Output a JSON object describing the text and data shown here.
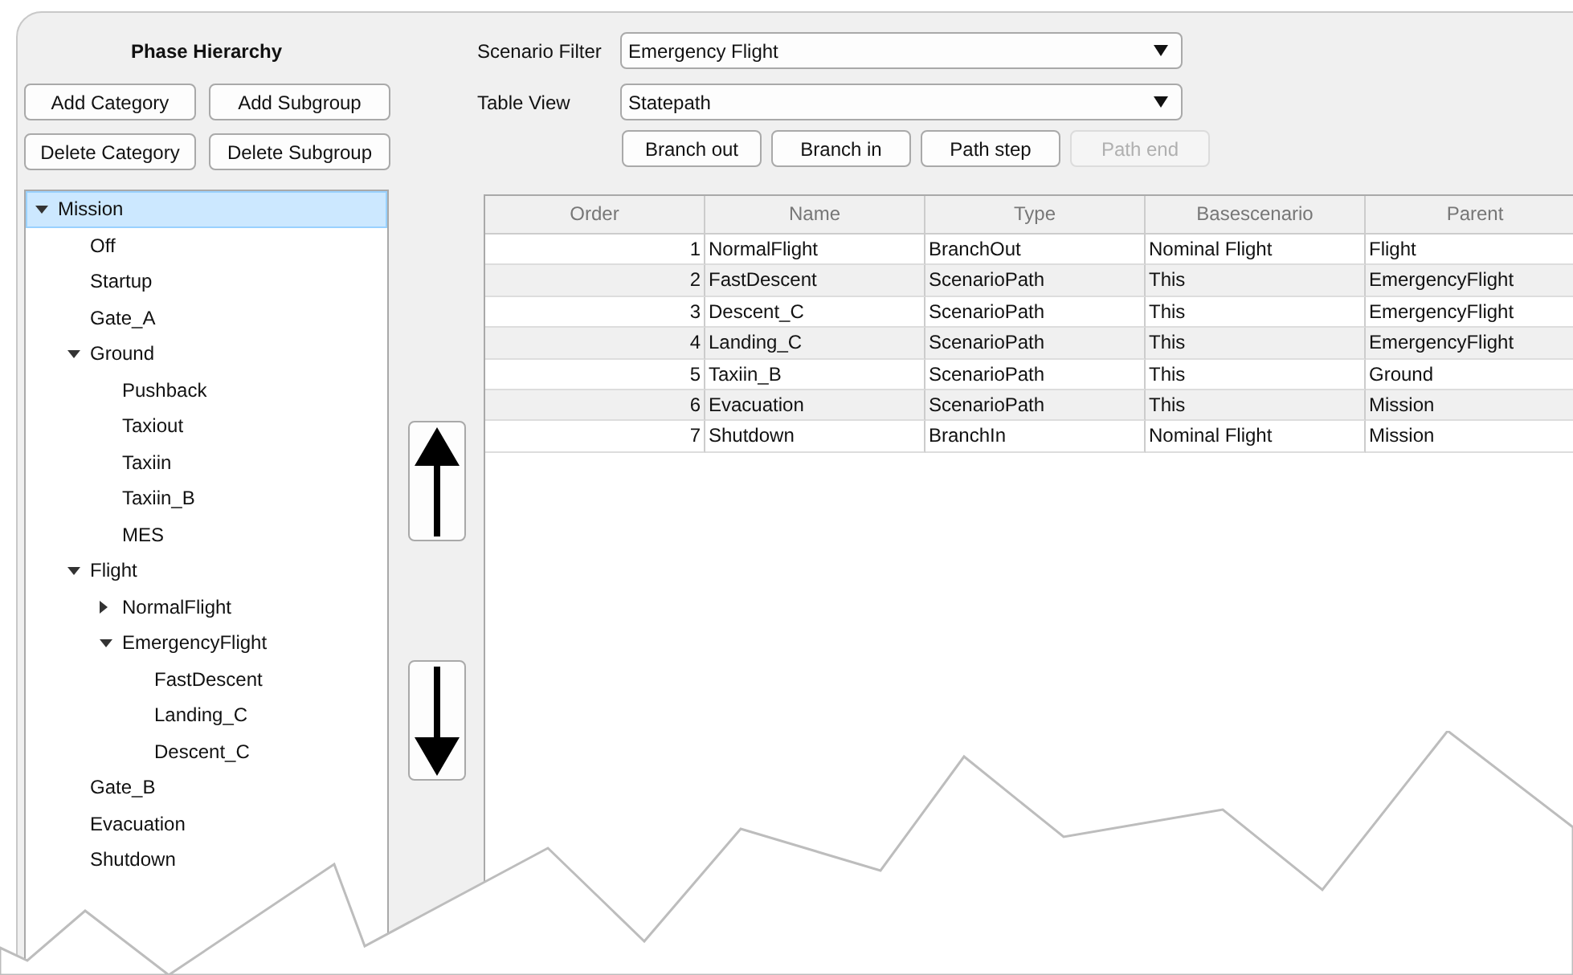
{
  "hierarchy": {
    "title": "Phase Hierarchy",
    "buttons": [
      "Add Category",
      "Add Subgroup",
      "Delete Category",
      "Delete Subgroup"
    ],
    "tree": [
      {
        "label": "Mission",
        "selected": true,
        "expanded": true,
        "children": [
          {
            "label": "Off",
            "selected": false
          },
          {
            "label": "Startup",
            "selected": false
          },
          {
            "label": "Gate_A",
            "selected": false
          },
          {
            "label": "Ground",
            "selected": false,
            "expanded": true,
            "children": [
              {
                "label": "Pushback",
                "selected": false
              },
              {
                "label": "Taxiout",
                "selected": false
              },
              {
                "label": "Taxiin",
                "selected": false
              },
              {
                "label": "Taxiin_B",
                "selected": false
              },
              {
                "label": "MES",
                "selected": false
              }
            ]
          },
          {
            "label": "Flight",
            "selected": false,
            "expanded": true,
            "children": [
              {
                "label": "NormalFlight",
                "selected": false,
                "expanded": false
              },
              {
                "label": "EmergencyFlight",
                "selected": false,
                "expanded": true,
                "children": [
                  {
                    "label": "FastDescent",
                    "selected": false
                  },
                  {
                    "label": "Landing_C",
                    "selected": false
                  },
                  {
                    "label": "Descent_C",
                    "selected": false
                  }
                ]
              }
            ]
          },
          {
            "label": "Gate_B",
            "selected": false
          },
          {
            "label": "Evacuation",
            "selected": false
          },
          {
            "label": "Shutdown",
            "selected": false
          }
        ]
      }
    ]
  },
  "filters": [
    {
      "label": "Scenario Filter",
      "value": "Emergency Flight"
    },
    {
      "label": "Table View",
      "value": "Statepath"
    }
  ],
  "path_buttons": [
    {
      "label": "Branch out",
      "disabled": false
    },
    {
      "label": "Branch in",
      "disabled": false
    },
    {
      "label": "Path step",
      "disabled": false
    },
    {
      "label": "Path end",
      "disabled": true
    }
  ],
  "table": {
    "columns": [
      "Order",
      "Name",
      "Type",
      "Basescenario",
      "Parent"
    ],
    "rows": [
      [
        "1",
        "NormalFlight",
        "BranchOut",
        "Nominal Flight",
        "Flight"
      ],
      [
        "2",
        "FastDescent",
        "ScenarioPath",
        "This",
        "EmergencyFlight"
      ],
      [
        "3",
        "Descent_C",
        "ScenarioPath",
        "This",
        "EmergencyFlight"
      ],
      [
        "4",
        "Landing_C",
        "ScenarioPath",
        "This",
        "EmergencyFlight"
      ],
      [
        "5",
        "Taxiin_B",
        "ScenarioPath",
        "This",
        "Ground"
      ],
      [
        "6",
        "Evacuation",
        "ScenarioPath",
        "This",
        "Mission"
      ],
      [
        "7",
        "Shutdown",
        "BranchIn",
        "Nominal Flight",
        "Mission"
      ]
    ]
  }
}
